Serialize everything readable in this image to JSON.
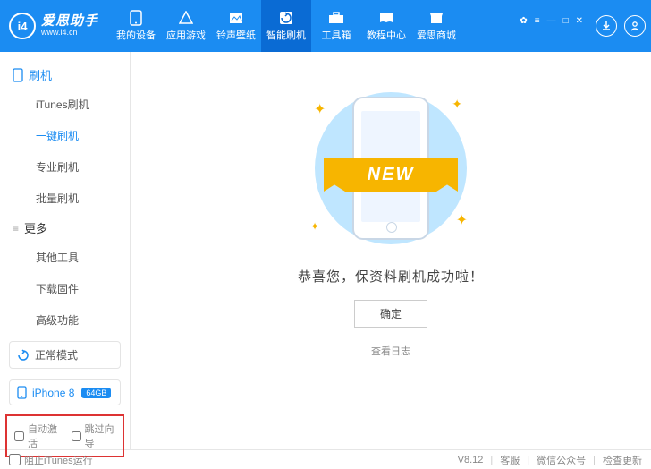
{
  "logo": {
    "badge": "i4",
    "title": "爱思助手",
    "url": "www.i4.cn"
  },
  "nav": [
    {
      "label": "我的设备"
    },
    {
      "label": "应用游戏"
    },
    {
      "label": "铃声壁纸"
    },
    {
      "label": "智能刷机",
      "active": true
    },
    {
      "label": "工具箱"
    },
    {
      "label": "教程中心"
    },
    {
      "label": "爱思商城"
    }
  ],
  "sidebar": {
    "brush_title": "刷机",
    "brush_items": [
      {
        "label": "iTunes刷机"
      },
      {
        "label": "一键刷机",
        "active": true
      },
      {
        "label": "专业刷机"
      },
      {
        "label": "批量刷机"
      }
    ],
    "more_title": "更多",
    "more_items": [
      {
        "label": "其他工具"
      },
      {
        "label": "下载固件"
      },
      {
        "label": "高级功能"
      }
    ],
    "mode": "正常模式",
    "device": {
      "name": "iPhone 8",
      "capacity": "64GB"
    },
    "checkboxes": {
      "auto_activate": "自动激活",
      "skip_guide": "跳过向导"
    }
  },
  "main": {
    "ribbon": "NEW",
    "success_message": "恭喜您，保资料刷机成功啦！",
    "ok_button": "确定",
    "view_log": "查看日志"
  },
  "footer": {
    "block_itunes": "阻止iTunes运行",
    "version": "V8.12",
    "links": {
      "service": "客服",
      "wechat": "微信公众号",
      "check_update": "检查更新"
    }
  }
}
